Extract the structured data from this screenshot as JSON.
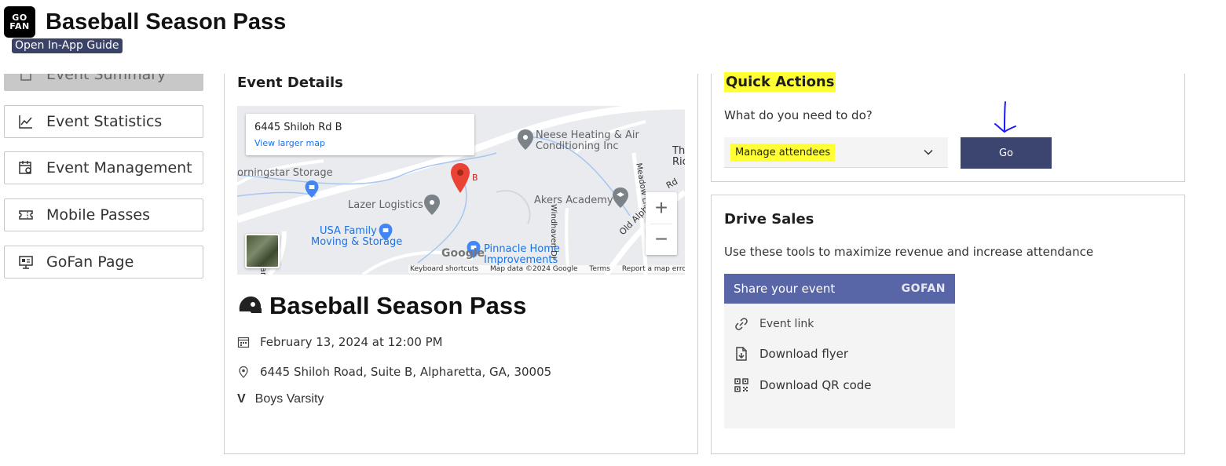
{
  "header": {
    "logo_line1": "GO",
    "logo_line2": "FAN",
    "title": "Baseball Season Pass",
    "guide_badge": "Open In-App Guide"
  },
  "sidebar": {
    "items": [
      {
        "label": "Event Summary",
        "icon": "square-icon",
        "active": true
      },
      {
        "label": "Event Statistics",
        "icon": "line-chart-icon"
      },
      {
        "label": "Event Management",
        "icon": "calendar-gear-icon"
      },
      {
        "label": "Mobile Passes",
        "icon": "ticket-icon"
      },
      {
        "label": "GoFan Page",
        "icon": "monitor-icon"
      }
    ]
  },
  "event_details": {
    "heading": "Event Details",
    "map": {
      "popup_address": "6445 Shiloh Rd B",
      "popup_link": "View larger map",
      "marker_label": "B",
      "places": {
        "neese": "Neese Heating & Air",
        "neese2": "Conditioning Inc",
        "morningstar": "orningstar Storage",
        "lazer": "Lazer Logistics",
        "akers": "Akers Academy",
        "usa1": "USA Family",
        "usa2": "Moving & Storage",
        "pinnacle1": "Pinnacle Home",
        "pinnacle2": "Improvements",
        "mcfarland": "McFarland P",
        "windhaven": "Windhaven Dr",
        "meadow": "Meadow Ln",
        "oldalph": "Old Alph",
        "rd": "Rd",
        "th": "Th",
        "ric": "Ric",
        "google": "Google"
      },
      "footer": [
        "Keyboard shortcuts",
        "Map data ©2024 Google",
        "Terms",
        "Report a map error"
      ],
      "zoom_in": "+",
      "zoom_out": "−"
    },
    "event_title": "Baseball Season Pass",
    "date": "February 13, 2024 at 12:00 PM",
    "address": "6445 Shiloh Road, Suite B, Alpharetta, GA, 30005",
    "level_letter": "V",
    "level": "Boys Varsity"
  },
  "quick_actions": {
    "heading": "Quick Actions",
    "prompt": "What do you need to do?",
    "selected": "Manage attendees",
    "go_label": "Go",
    "highlight_color": "#ffff33",
    "annotation": "arrow-down-icon"
  },
  "drive_sales": {
    "heading": "Drive Sales",
    "description": "Use these tools to maximize revenue and increase attendance",
    "share_title": "Share your event",
    "share_brand": "GOFAN",
    "items": [
      {
        "label": "Event link",
        "icon": "link-icon"
      },
      {
        "label": "Download flyer",
        "icon": "file-download-icon"
      },
      {
        "label": "Download QR code",
        "icon": "qr-code-icon"
      }
    ]
  },
  "colors": {
    "accent": "#3c4570",
    "share_header": "#5865a6",
    "map_link": "#1a73e8",
    "marker": "#ea4335"
  }
}
